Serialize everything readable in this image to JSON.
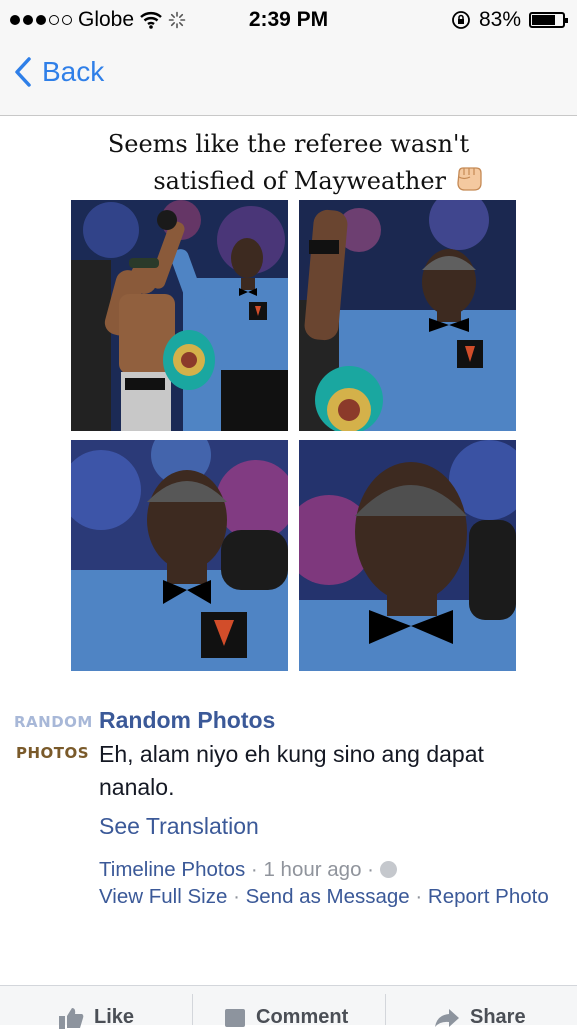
{
  "status_bar": {
    "carrier": "Globe",
    "time": "2:39 PM",
    "battery": "83%",
    "battery_level": 0.83
  },
  "nav": {
    "back_label": "Back"
  },
  "photo": {
    "caption_line1": "Seems like the referee wasn't",
    "caption_line2": "satisfied of Mayweather"
  },
  "post": {
    "page_avatar_line1": "RANDOM",
    "page_avatar_line2": "PHOTOS",
    "author": "Random Photos",
    "text": "Eh, alam niyo eh kung sino ang dapat nanalo.",
    "see_translation": "See Translation",
    "album": "Timeline Photos",
    "time": "1 hour ago",
    "view_full_size": "View Full Size",
    "send_as_message": "Send as Message",
    "report_photo": "Report Photo"
  },
  "actions": {
    "like": "Like",
    "comment": "Comment",
    "share": "Share"
  },
  "colors": {
    "ios_blue": "#2f7fe8",
    "facebook_blue": "#3b5998",
    "meta_grey": "#90949c"
  }
}
